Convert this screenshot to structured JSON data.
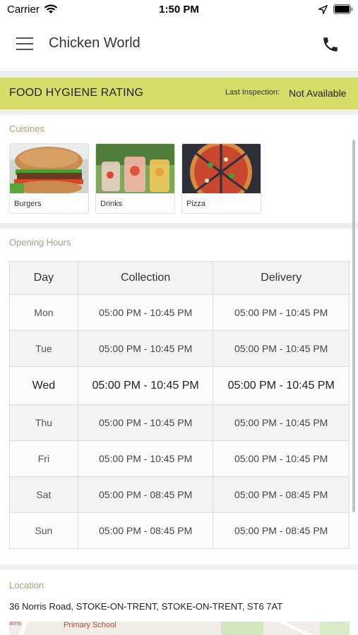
{
  "status_bar": {
    "carrier": "Carrier",
    "time": "1:50 PM",
    "icons": [
      "wifi-icon",
      "location-arrow-icon",
      "battery-icon"
    ]
  },
  "header": {
    "title": "Chicken World",
    "icons": [
      "menu-icon",
      "phone-icon"
    ]
  },
  "hygiene": {
    "title": "FOOD HYGIENE RATING",
    "inspection_label": "Last Inspection:",
    "inspection_value": "Not Available",
    "color": "#d8dc68"
  },
  "cuisines": {
    "label": "Cuisines",
    "items": [
      {
        "name": "Burgers"
      },
      {
        "name": "Drinks"
      },
      {
        "name": "Pizza"
      }
    ]
  },
  "opening_hours": {
    "label": "Opening Hours",
    "headers": [
      "Day",
      "Collection",
      "Delivery"
    ],
    "rows": [
      {
        "day": "Mon",
        "collection": "05:00 PM - 10:45 PM",
        "delivery": "05:00 PM - 10:45 PM"
      },
      {
        "day": "Tue",
        "collection": "05:00 PM - 10:45 PM",
        "delivery": "05:00 PM - 10:45 PM"
      },
      {
        "day": "Wed",
        "collection": "05:00 PM - 10:45 PM",
        "delivery": "05:00 PM - 10:45 PM"
      },
      {
        "day": "Thu",
        "collection": "05:00 PM - 10:45 PM",
        "delivery": "05:00 PM - 10:45 PM"
      },
      {
        "day": "Fri",
        "collection": "05:00 PM - 10:45 PM",
        "delivery": "05:00 PM - 10:45 PM"
      },
      {
        "day": "Sat",
        "collection": "05:00 PM - 08:45 PM",
        "delivery": "05:00 PM - 08:45 PM"
      },
      {
        "day": "Sun",
        "collection": "05:00 PM - 08:45 PM",
        "delivery": "05:00 PM - 08:45 PM"
      }
    ]
  },
  "location": {
    "label": "Location",
    "address": "36 Norris Road, STOKE-ON-TRENT, STOKE-ON-TRENT, ST6 7AT",
    "map_label": "Primary School",
    "map_label_left": "ams"
  }
}
